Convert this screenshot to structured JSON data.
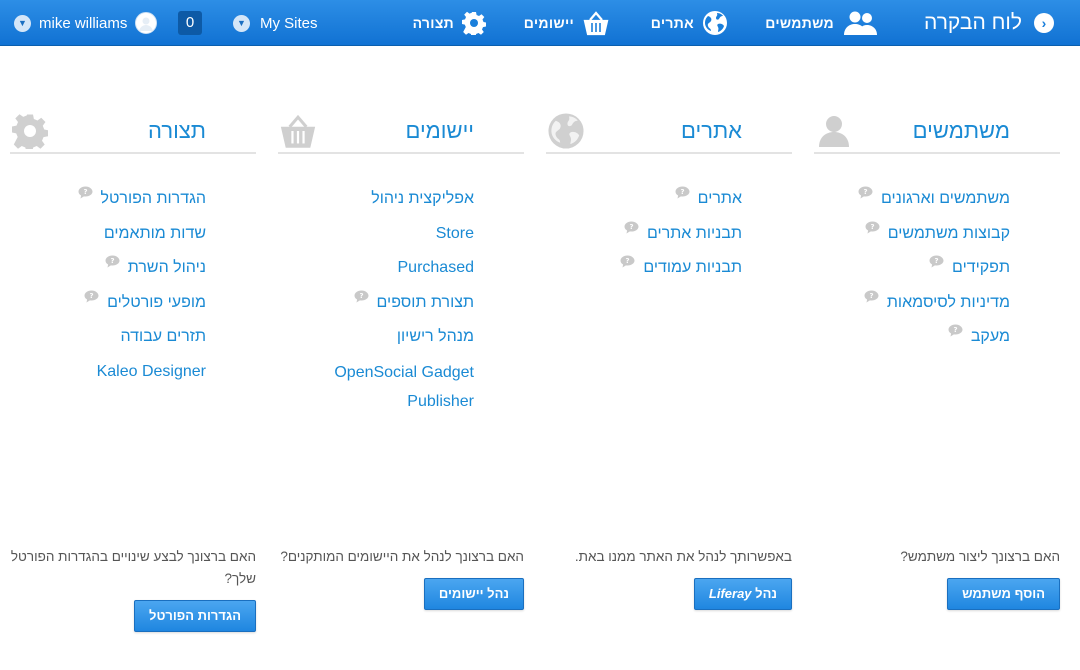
{
  "topbar": {
    "title": "לוח הבקרה",
    "nav": {
      "users": "משתמשים",
      "sites": "אתרים",
      "apps": "יישומים",
      "control": "תצורה"
    },
    "my_sites": "My Sites",
    "notification_count": "0",
    "user_name": "mike williams"
  },
  "columns": {
    "users": {
      "title": "משתמשים",
      "items": [
        "משתמשים וארגונים",
        "קבוצות משתמשים",
        "תפקידים",
        "מדיניות לסיסמאות",
        "מעקב"
      ],
      "prompt": "האם ברצונך ליצור משתמש?",
      "button": "הוסף משתמש"
    },
    "sites": {
      "title": "אתרים",
      "items": [
        "אתרים",
        "תבניות אתרים",
        "תבניות עמודים"
      ],
      "prompt": "באפשרותך לנהל את האתר ממנו באת.",
      "button_prefix": "נהל",
      "button_brand": "Liferay"
    },
    "apps": {
      "title": "יישומים",
      "items": [
        "אפליקצית ניהול",
        "Store",
        "Purchased",
        "תצורת תוספים",
        "מנהל רישיון",
        "OpenSocial Gadget Publisher"
      ],
      "prompt": "האם ברצונך לנהל את היישומים המותקנים?",
      "button": "נהל יישומים"
    },
    "control": {
      "title": "תצורה",
      "items": [
        "הגדרות הפורטל",
        "שדות מותאמים",
        "ניהול השרת",
        "מופעי פורטלים",
        "תזרים עבודה",
        "Kaleo Designer"
      ],
      "prompt": "האם ברצונך לבצע שינויים בהגדרות הפורטל שלך?",
      "button": "הגדרות הפורטל"
    }
  },
  "icons": {
    "back": "chevron-right-icon",
    "users": "users-icon",
    "sites": "globe-icon",
    "apps": "basket-icon",
    "control": "gear-icon",
    "help": "help-bubble-icon"
  },
  "colors": {
    "topbar": "#1a7fdb",
    "link": "#1a8ad4",
    "button": "#2b8fe6",
    "icon_gray": "#c7c7c7"
  }
}
